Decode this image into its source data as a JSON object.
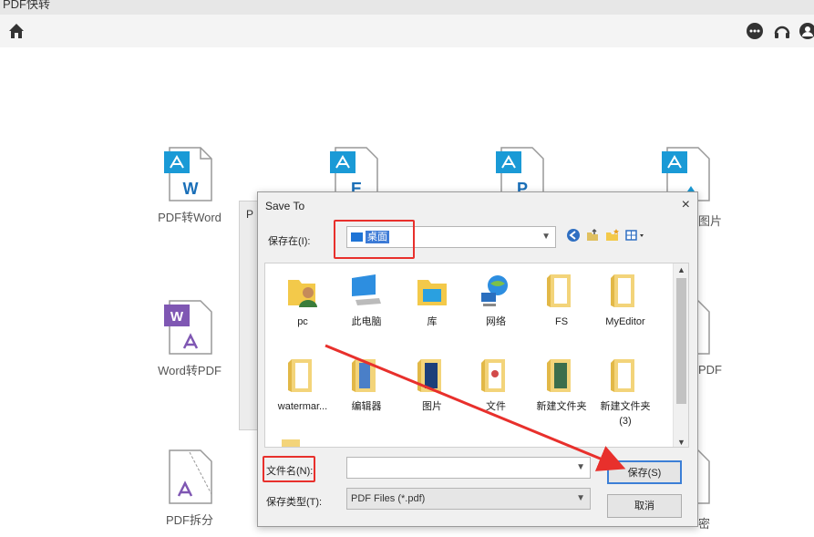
{
  "window": {
    "title": "PDF快转"
  },
  "tools": [
    {
      "label": "PDF转Word",
      "letter": "W"
    },
    {
      "letter": "E"
    },
    {
      "letter": "P"
    },
    {
      "label_clip": "图片"
    },
    {
      "label": "Word转PDF",
      "letter": "W"
    },
    {
      "label_clip": "PDF"
    },
    {
      "label": "PDF拆分"
    },
    {
      "label_clip": "密"
    }
  ],
  "background_dialog": {
    "title_clip": "P"
  },
  "save_dialog": {
    "title": "Save To",
    "close": "×",
    "location_label": "保存在(I):",
    "location_value": "桌面",
    "items": [
      {
        "label": "pc",
        "icon": "user-folder-icon"
      },
      {
        "label": "此电脑",
        "icon": "computer-icon"
      },
      {
        "label": "库",
        "icon": "library-icon"
      },
      {
        "label": "网络",
        "icon": "network-icon"
      },
      {
        "label": "FS",
        "icon": "folder-icon"
      },
      {
        "label": "MyEditor",
        "icon": "folder-icon"
      },
      {
        "label": "watermar...",
        "icon": "folder-icon"
      },
      {
        "label": "编辑器",
        "icon": "folder-icon"
      },
      {
        "label": "图片",
        "icon": "folder-icon"
      },
      {
        "label": "文件",
        "icon": "folder-icon"
      },
      {
        "label": "新建文件夹",
        "icon": "folder-icon"
      },
      {
        "label": "新建文件夹\n(3)",
        "icon": "folder-icon"
      }
    ],
    "filename_label": "文件名(N):",
    "filename_value": "",
    "filetype_label": "保存类型(T):",
    "filetype_value": "PDF Files (*.pdf)",
    "save_button": "保存(S)",
    "cancel_button": "取消"
  },
  "colors": {
    "accent_red": "#e8302c",
    "pdf_blue": "#1a9ad6",
    "word_purple": "#7f57b3"
  }
}
